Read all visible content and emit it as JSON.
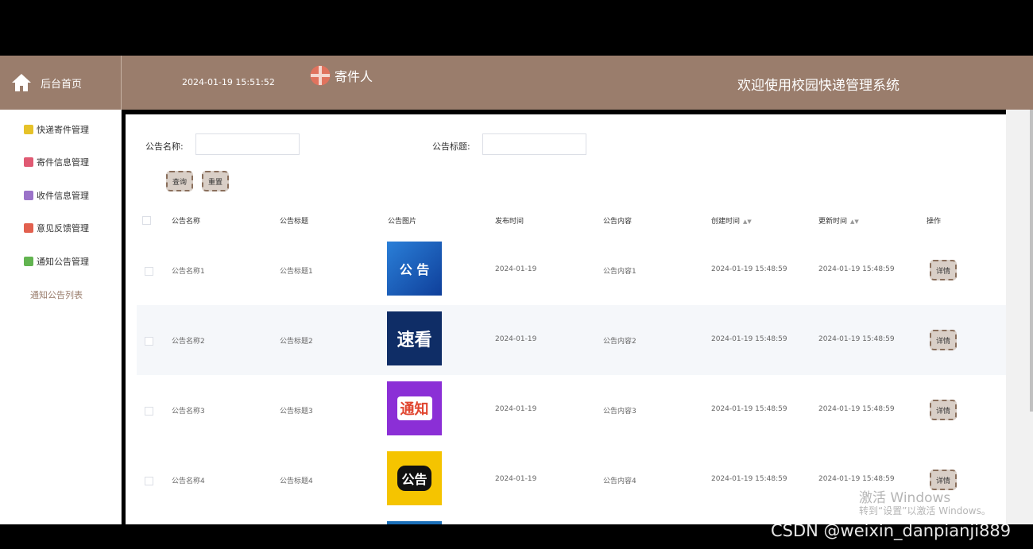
{
  "header": {
    "home_label": "后台首页",
    "datetime": "2024-01-19 15:51:52",
    "user_name": "寄件人",
    "welcome": "欢迎使用校园快递管理系统",
    "color": "#9a7d6c"
  },
  "sidebar": {
    "items": [
      {
        "label": "快递寄件管理",
        "icon": "cube-icon",
        "color": "#e6c229"
      },
      {
        "label": "寄件信息管理",
        "icon": "document-icon",
        "color": "#e05a73"
      },
      {
        "label": "收件信息管理",
        "icon": "archive-icon",
        "color": "#9b73c9"
      },
      {
        "label": "意见反馈管理",
        "icon": "grid-icon",
        "color": "#e2604e"
      },
      {
        "label": "通知公告管理",
        "icon": "message-icon",
        "color": "#62b450"
      }
    ],
    "active_sub": "通知公告列表"
  },
  "search": {
    "name_label": "公告名称:",
    "title_label": "公告标题:",
    "name_value": "",
    "title_value": "",
    "query_button": "查询",
    "reset_button": "重置"
  },
  "table": {
    "headers": [
      "公告名称",
      "公告标题",
      "公告图片",
      "发布时间",
      "公告内容",
      "创建时间",
      "更新时间",
      "操作"
    ],
    "detail_label": "详情",
    "rows": [
      {
        "name": "公告名称1",
        "title": "公告标题1",
        "image_text": "公 告",
        "image_bg": "#1f5fbf",
        "date": "2024-01-19",
        "content": "公告内容1",
        "created": "2024-01-19 15:48:59",
        "updated": "2024-01-19 15:48:59"
      },
      {
        "name": "公告名称2",
        "title": "公告标题2",
        "image_text": "速看",
        "image_bg": "#0f2d66",
        "date": "2024-01-19",
        "content": "公告内容2",
        "created": "2024-01-19 15:48:59",
        "updated": "2024-01-19 15:48:59"
      },
      {
        "name": "公告名称3",
        "title": "公告标题3",
        "image_text": "通知",
        "image_bg": "#8b2fd6",
        "date": "2024-01-19",
        "content": "公告内容3",
        "created": "2024-01-19 15:48:59",
        "updated": "2024-01-19 15:48:59"
      },
      {
        "name": "公告名称4",
        "title": "公告标题4",
        "image_text": "公告",
        "image_bg": "#f5c400",
        "date": "2024-01-19",
        "content": "公告内容4",
        "created": "2024-01-19 15:48:59",
        "updated": "2024-01-19 15:48:59"
      }
    ]
  },
  "overlay": {
    "activate_line1": "激活 Windows",
    "activate_line2": "转到“设置”以激活 Windows。",
    "csdn": "CSDN @weixin_danpianji889"
  }
}
